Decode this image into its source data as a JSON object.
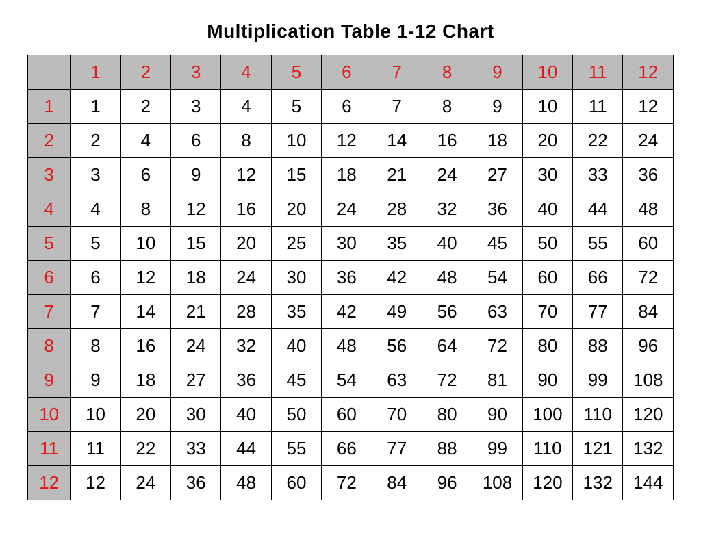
{
  "title": "Multiplication Table 1-12 Chart",
  "chart_data": {
    "type": "table",
    "title": "Multiplication Table 1-12 Chart",
    "col_headers": [
      1,
      2,
      3,
      4,
      5,
      6,
      7,
      8,
      9,
      10,
      11,
      12
    ],
    "row_headers": [
      1,
      2,
      3,
      4,
      5,
      6,
      7,
      8,
      9,
      10,
      11,
      12
    ],
    "rows": [
      [
        1,
        2,
        3,
        4,
        5,
        6,
        7,
        8,
        9,
        10,
        11,
        12
      ],
      [
        2,
        4,
        6,
        8,
        10,
        12,
        14,
        16,
        18,
        20,
        22,
        24
      ],
      [
        3,
        6,
        9,
        12,
        15,
        18,
        21,
        24,
        27,
        30,
        33,
        36
      ],
      [
        4,
        8,
        12,
        16,
        20,
        24,
        28,
        32,
        36,
        40,
        44,
        48
      ],
      [
        5,
        10,
        15,
        20,
        25,
        30,
        35,
        40,
        45,
        50,
        55,
        60
      ],
      [
        6,
        12,
        18,
        24,
        30,
        36,
        42,
        48,
        54,
        60,
        66,
        72
      ],
      [
        7,
        14,
        21,
        28,
        35,
        42,
        49,
        56,
        63,
        70,
        77,
        84
      ],
      [
        8,
        16,
        24,
        32,
        40,
        48,
        56,
        64,
        72,
        80,
        88,
        96
      ],
      [
        9,
        18,
        27,
        36,
        45,
        54,
        63,
        72,
        81,
        90,
        99,
        108
      ],
      [
        10,
        20,
        30,
        40,
        50,
        60,
        70,
        80,
        90,
        100,
        110,
        120
      ],
      [
        11,
        22,
        33,
        44,
        55,
        66,
        77,
        88,
        99,
        110,
        121,
        132
      ],
      [
        12,
        24,
        36,
        48,
        60,
        72,
        84,
        96,
        108,
        120,
        132,
        144
      ]
    ]
  },
  "colors": {
    "header_bg": "#bcbcbc",
    "header_text": "#e11b1b",
    "cell_bg": "#ffffff",
    "cell_text": "#000000",
    "border": "#000000"
  }
}
